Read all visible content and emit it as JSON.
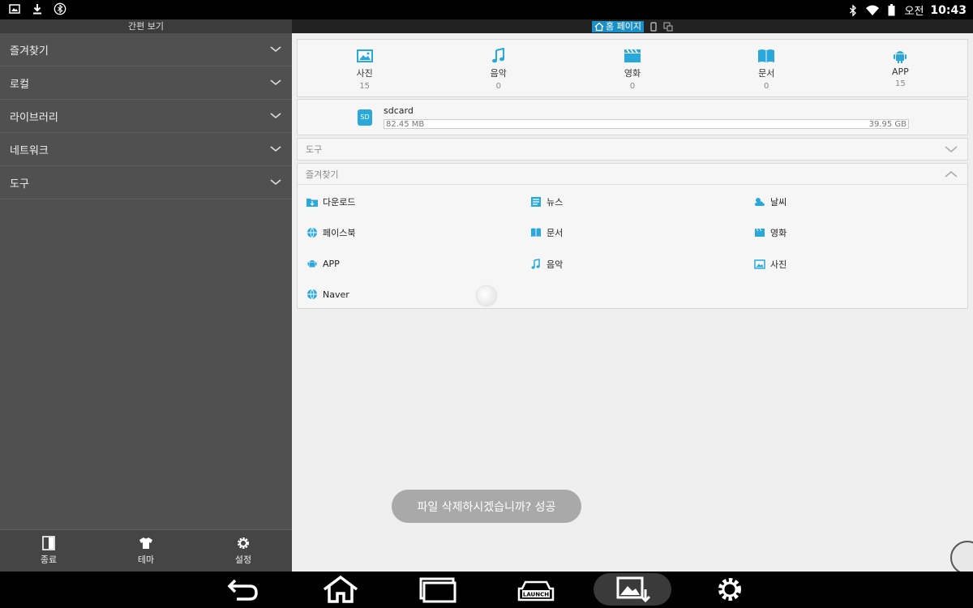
{
  "status": {
    "time": "10:43",
    "ampm": "오전"
  },
  "sidebar": {
    "title": "간편 보기",
    "items": [
      {
        "label": "즐겨찾기"
      },
      {
        "label": "로컬"
      },
      {
        "label": "라이브러리"
      },
      {
        "label": "네트워크"
      },
      {
        "label": "도구"
      }
    ],
    "bottom": {
      "exit": "종료",
      "theme": "테마",
      "settings": "설정"
    }
  },
  "topbar": {
    "home_tab": "홈 페이지"
  },
  "categories": [
    {
      "label": "사진",
      "count": "15",
      "icon": "image-icon"
    },
    {
      "label": "음악",
      "count": "0",
      "icon": "music-icon"
    },
    {
      "label": "영화",
      "count": "0",
      "icon": "movie-icon"
    },
    {
      "label": "문서",
      "count": "0",
      "icon": "book-icon"
    },
    {
      "label": "APP",
      "count": "15",
      "icon": "android-icon"
    }
  ],
  "storage": {
    "badge": "SD",
    "name": "sdcard",
    "used": "82.45 MB",
    "total": "39.95 GB"
  },
  "sections": {
    "tools": "도구",
    "favorites": "즐겨찾기"
  },
  "favorites": [
    {
      "label": "다운로드"
    },
    {
      "label": "뉴스"
    },
    {
      "label": "날씨"
    },
    {
      "label": "페이스북"
    },
    {
      "label": "문서"
    },
    {
      "label": "영화"
    },
    {
      "label": "APP"
    },
    {
      "label": "음악"
    },
    {
      "label": "사진"
    },
    {
      "label": "Naver"
    }
  ],
  "toast": "파일 삭제하시겠습니까? 성공",
  "colors": {
    "accent": "#2aa8dc",
    "sidebar": "#505050"
  }
}
